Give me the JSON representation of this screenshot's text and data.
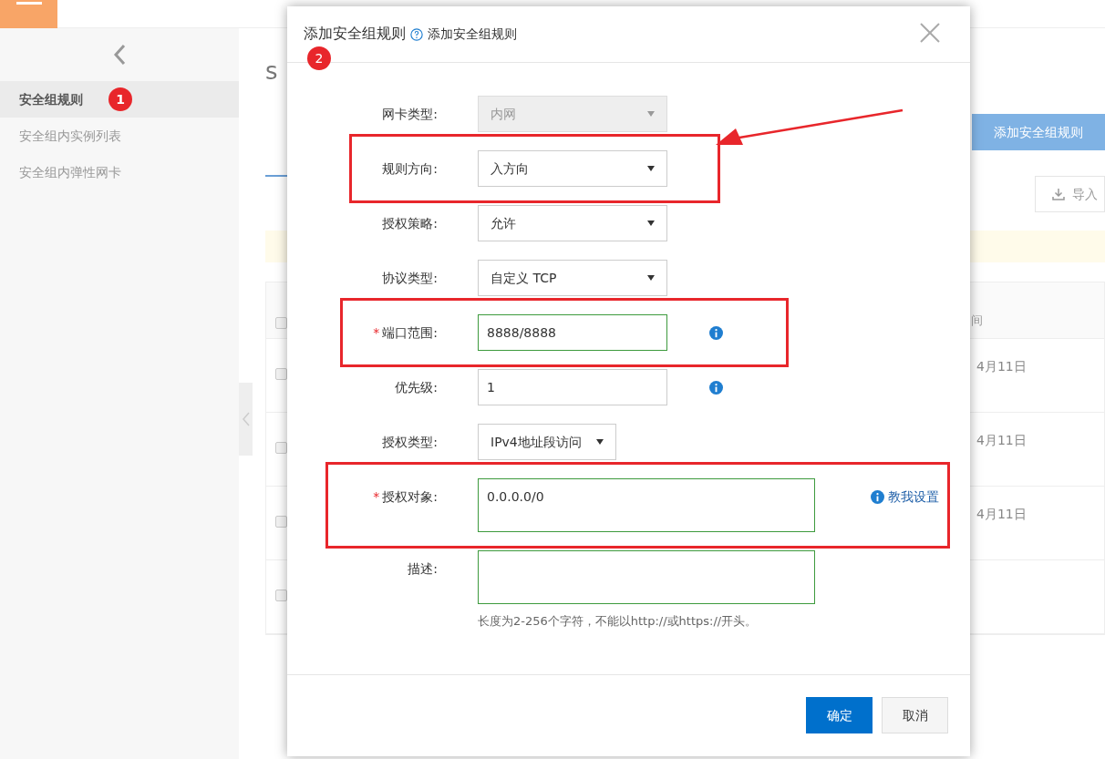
{
  "sidebar": {
    "items": [
      {
        "label": "安全组规则",
        "selected": true,
        "badge": "1"
      },
      {
        "label": "安全组内实例列表",
        "selected": false
      },
      {
        "label": "安全组内弹性网卡",
        "selected": false
      }
    ]
  },
  "page": {
    "title": "s",
    "add_button": "添加安全组规则",
    "import_button": "导入",
    "table": {
      "columns": [
        "间"
      ],
      "header_checked": false,
      "rows": [
        {
          "checked": false,
          "cells": [
            "4月11日"
          ]
        },
        {
          "checked": false,
          "cells": [
            "4月11日"
          ]
        },
        {
          "checked": false,
          "cells": [
            "4月11日"
          ]
        },
        {
          "checked": false,
          "cells": []
        }
      ]
    }
  },
  "dialog": {
    "title": "添加安全组规则",
    "title_badge": "2",
    "help_text": "添加安全组规则",
    "fields": [
      {
        "label": "网卡类型:",
        "kind": "select",
        "value": "内网",
        "disabled": true,
        "highlighted": false
      },
      {
        "label": "规则方向:",
        "kind": "select",
        "value": "入方向",
        "disabled": false,
        "highlighted": true
      },
      {
        "label": "授权策略:",
        "kind": "select",
        "value": "允许",
        "disabled": false,
        "highlighted": false
      },
      {
        "label": "协议类型:",
        "kind": "select",
        "value": "自定义 TCP",
        "disabled": false,
        "highlighted": false
      },
      {
        "label": "端口范围:",
        "required_mark": "*",
        "kind": "input",
        "value": "8888/8888",
        "valid": true,
        "info": true,
        "highlighted": true
      },
      {
        "label": "优先级:",
        "kind": "input",
        "value": "1",
        "valid": false,
        "info": true,
        "highlighted": false
      },
      {
        "label": "授权类型:",
        "kind": "select",
        "value": "IPv4地址段访问",
        "disabled": false,
        "compact": true,
        "highlighted": false
      },
      {
        "label": "授权对象:",
        "required_mark": "*",
        "kind": "textarea",
        "value": "0.0.0.0/0",
        "valid": true,
        "link": "教我设置",
        "highlighted": true
      },
      {
        "label": "描述:",
        "kind": "textarea",
        "valid": true,
        "hint": "长度为2-256个字符，不能以http://或https://开头。",
        "highlighted": false
      }
    ],
    "buttons": [
      {
        "label": "确定",
        "primary": true
      },
      {
        "label": "取消",
        "primary": false
      }
    ]
  }
}
